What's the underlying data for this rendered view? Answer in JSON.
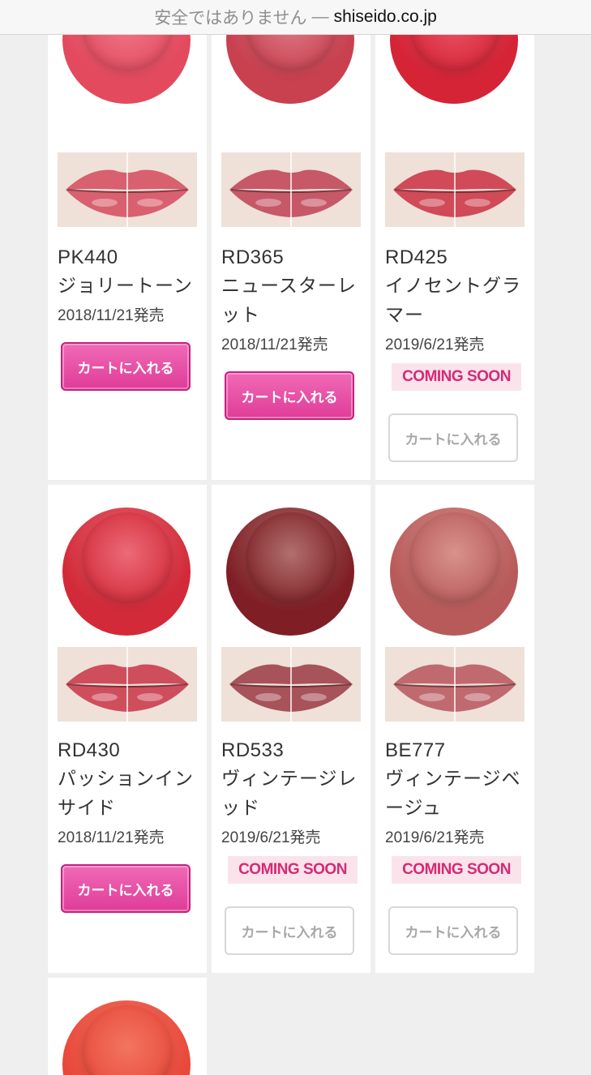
{
  "url_bar": {
    "insecure_text": "安全ではありません",
    "separator": "—",
    "domain": "shiseido.co.jp"
  },
  "cart_label": "カートに入れる",
  "coming_soon_label": "COMING SOON",
  "products": [
    {
      "code": "PK440",
      "name": "ジョリートーン",
      "release": "2018/11/21発売",
      "status": "available",
      "color_outer": "#e34a5e",
      "color_inner": "#f07a8a",
      "lip_color": "#d9606e"
    },
    {
      "code": "RD365",
      "name": "ニュースターレット",
      "release": "2018/11/21発売",
      "status": "available",
      "color_outer": "#c9404f",
      "color_inner": "#dc7c86",
      "lip_color": "#c65867"
    },
    {
      "code": "RD425",
      "name": "イノセントグラマー",
      "release": "2019/6/21発売",
      "status": "coming_soon",
      "color_outer": "#d42436",
      "color_inner": "#ea5565",
      "lip_color": "#d04a58"
    },
    {
      "code": "RD430",
      "name": "パッションインサイド",
      "release": "2018/11/21発売",
      "status": "available",
      "color_outer": "#d22a38",
      "color_inner": "#ec6a78",
      "lip_color": "#cf4e5c"
    },
    {
      "code": "RD533",
      "name": "ヴィンテージレッド",
      "release": "2019/6/21発売",
      "status": "coming_soon",
      "color_outer": "#7f1f25",
      "color_inner": "#b0706e",
      "lip_color": "#a8525a"
    },
    {
      "code": "BE777",
      "name": "ヴィンテージベージュ",
      "release": "2019/6/21発売",
      "status": "coming_soon",
      "color_outer": "#b85a5a",
      "color_inner": "#d8928c",
      "lip_color": "#c06a70"
    },
    {
      "code": "",
      "name": "",
      "release": "",
      "status": "partial",
      "color_outer": "#e8483a",
      "color_inner": "#f27560",
      "lip_color": "#e05a4a"
    }
  ]
}
